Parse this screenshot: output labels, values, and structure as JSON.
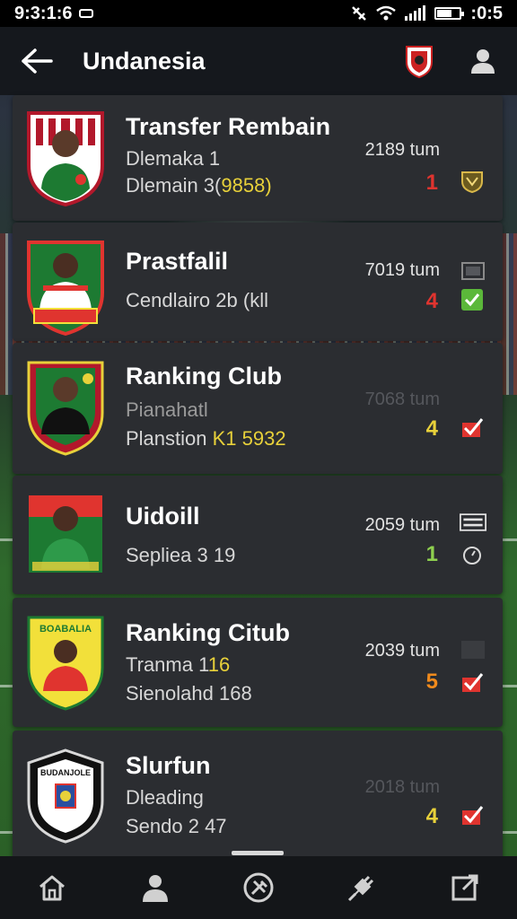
{
  "status_bar": {
    "time": "9:3:1:6",
    "battery_time": ":0:5"
  },
  "app_bar": {
    "title": "Undanesia"
  },
  "cards": [
    {
      "title": "Transfer Rembain",
      "line1": "Dlemaka 1",
      "line2": "Dlemain 3(",
      "line2_highlight": "9858)",
      "meta": "2189 tum",
      "number": "1",
      "number_color": "#e0342f",
      "crest_colors": [
        "#b2182b",
        "#ffffff",
        "#1d7a32"
      ],
      "action_icon": "eagle-badge-icon"
    },
    {
      "title": "Prastfalil",
      "line1": "",
      "line2": "Cendlairo 2b (kll",
      "line2_highlight": "",
      "meta": "7019 tum",
      "number": "4",
      "number_color": "#e0342f",
      "crest_colors": [
        "#1d7a32",
        "#e0342f",
        "#ffffff"
      ],
      "action_icon": "checkbox-checked-icon"
    },
    {
      "title": "Ranking Club",
      "line1": "Pianahatl",
      "line2": "Planstion ",
      "line2_highlight": "K1 5932",
      "meta": "7068 tum",
      "number": "4",
      "number_color": "#e8d13a",
      "crest_colors": [
        "#b2182b",
        "#111111",
        "#1d7a32"
      ],
      "action_icon": "red-check-icon"
    },
    {
      "title": "Uidoill",
      "line1": "",
      "line2": "Sepliea 3 19",
      "line2_highlight": "",
      "meta": "2059 tum",
      "number": "1",
      "number_color": "#8fd14f",
      "crest_colors": [
        "#1d7a32",
        "#e0342f",
        "#1d7a32"
      ],
      "action_icon": "timer-icon"
    },
    {
      "title": "Ranking Citub",
      "line1": "Tranma 1",
      "line1_highlight": "16",
      "line2": "Sienolahd 168",
      "line2_highlight": "",
      "meta": "2039 tum",
      "number": "5",
      "number_color": "#f08a1c",
      "crest_colors": [
        "#f2e03a",
        "#e0342f",
        "#1d7a32"
      ],
      "crest_text": "BOABALIA",
      "action_icon": "red-check-icon"
    },
    {
      "title": "Slurfun",
      "line1": "Dleading",
      "line2": "Sendo 2 47",
      "line2_highlight": "",
      "meta": "2018 tum",
      "number": "4",
      "number_color": "#e8d13a",
      "crest_colors": [
        "#111111",
        "#ffffff",
        "#2a4fa0"
      ],
      "crest_text": "BUDANJOLE",
      "action_icon": "red-check-icon"
    }
  ],
  "bottom_nav": [
    "home",
    "profile",
    "tools",
    "plug",
    "export"
  ],
  "colors": {
    "accent_red": "#e0342f",
    "accent_green": "#5bb83a",
    "card_bg": "#2b2d31"
  }
}
